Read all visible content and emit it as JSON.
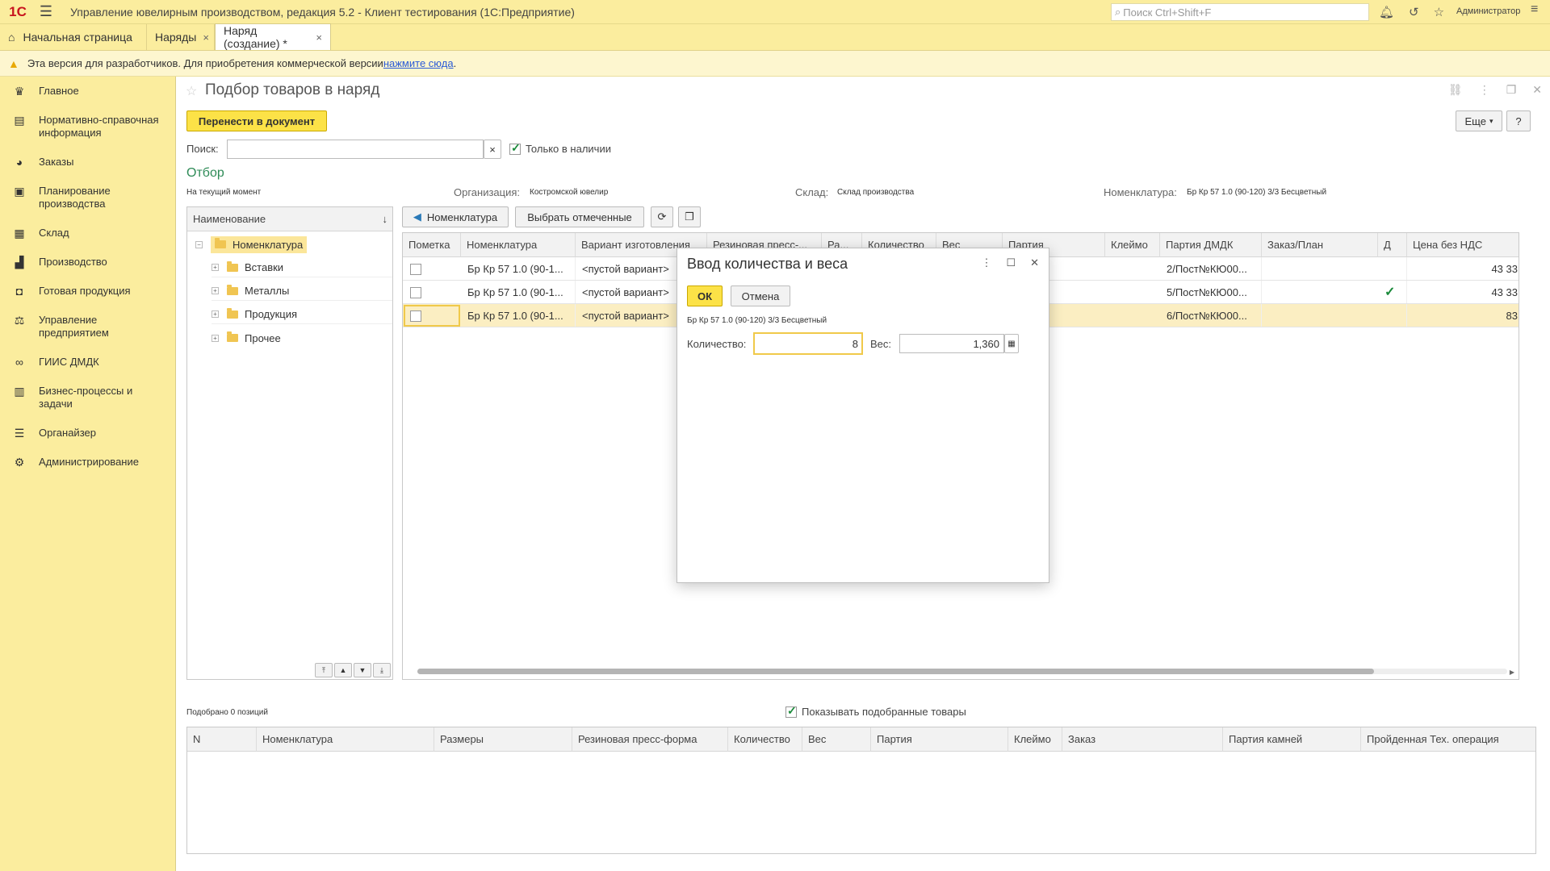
{
  "app": {
    "logo": "1С",
    "title": "Управление ювелирным производством, редакция 5.2  - Клиент тестирования (1С:Предприятие)",
    "search_placeholder": "Поиск Ctrl+Shift+F",
    "user": "Администратор"
  },
  "tabs": [
    {
      "label": "Начальная страница"
    },
    {
      "label": "Наряды"
    },
    {
      "label": "Наряд (создание) *"
    }
  ],
  "devbar": {
    "text": "Эта версия для разработчиков. Для приобретения коммерческой версии ",
    "link": "нажмите сюда",
    "tail": "."
  },
  "sidebar": {
    "items": [
      {
        "label": "Главное",
        "icon": "crown-icon"
      },
      {
        "label": "Нормативно-справочная информация",
        "icon": "books-icon"
      },
      {
        "label": "Заказы",
        "icon": "pie-icon"
      },
      {
        "label": "Планирование производства",
        "icon": "clipboard-icon"
      },
      {
        "label": "Склад",
        "icon": "grid-icon"
      },
      {
        "label": "Производство",
        "icon": "factory-icon"
      },
      {
        "label": "Готовая продукция",
        "icon": "bag-icon"
      },
      {
        "label": "Управление предприятием",
        "icon": "org-icon"
      },
      {
        "label": "ГИИС ДМДК",
        "icon": "link-icon"
      },
      {
        "label": "Бизнес-процессы и задачи",
        "icon": "process-icon"
      },
      {
        "label": "Органайзер",
        "icon": "organizer-icon"
      },
      {
        "label": "Администрирование",
        "icon": "gear-icon"
      }
    ]
  },
  "page": {
    "title": "Подбор товаров в наряд",
    "transfer_button": "Перенести в документ",
    "more_button": "Еще",
    "help_button": "?",
    "search_label": "Поиск:",
    "search_value": "",
    "only_available": "Только в наличии",
    "filter_title": "Отбор",
    "filter_moment": "На текущий момент",
    "org_label": "Организация:",
    "org_value": "Костромской ювелир",
    "warehouse_label": "Склад:",
    "warehouse_value": "Склад производства",
    "nom_label": "Номенклатура:",
    "nom_value": "Бр Кр 57 1.0 (90-120) 3/3 Бесцветный"
  },
  "tree": {
    "header": "Наименование",
    "sort": "↓",
    "root": "Номенклатура",
    "children": [
      "Вставки",
      "Металлы",
      "Продукция",
      "Прочее"
    ]
  },
  "grid_toolbar": {
    "nom_button": "Номенклатура",
    "select_marked": "Выбрать отмеченные"
  },
  "grid": {
    "columns": [
      "Пометка",
      "Номенклатура",
      "Вариант изготовления",
      "Резиновая пресс-...",
      "Ра...",
      "Количество",
      "Вес",
      "Партия",
      "Клеймо",
      "Партия ДМДК",
      "Заказ/План",
      "Д",
      "Цена без НДС"
    ],
    "rows": [
      {
        "nom": "Бр Кр 57 1.0 (90-1...",
        "variant": "<пустой вариант>",
        "batch": "2/Пост№КЮ00...",
        "d": "",
        "price": "43 33"
      },
      {
        "nom": "Бр Кр 57 1.0 (90-1...",
        "variant": "<пустой вариант>",
        "batch": "5/Пост№КЮ00...",
        "d": "✓",
        "price": "43 33"
      },
      {
        "nom": "Бр Кр 57 1.0 (90-1...",
        "variant": "<пустой вариант>",
        "batch": "6/Пост№КЮ00...",
        "d": "",
        "price": "83"
      }
    ]
  },
  "bottom": {
    "count_text": "Подобрано 0 позиций",
    "show_selected": "Показывать подобранные товары",
    "columns": [
      "N",
      "Номенклатура",
      "Размеры",
      "Резиновая пресс-форма",
      "Количество",
      "Вес",
      "Партия",
      "Клеймо",
      "Заказ",
      "Партия камней",
      "Пройденная Тех. операция"
    ]
  },
  "dialog": {
    "title": "Ввод количества и веса",
    "ok": "ОК",
    "cancel": "Отмена",
    "item": "Бр Кр 57 1.0 (90-120) 3/3 Бесцветный",
    "qty_label": "Количество:",
    "qty_value": "8",
    "weight_label": "Вес:",
    "weight_value": "1,360"
  },
  "colors": {
    "panel_yellow": "#fbed9e",
    "accent_button": "#fce247",
    "filter_green": "#2e8b57",
    "selected_row": "#fbeec2"
  }
}
